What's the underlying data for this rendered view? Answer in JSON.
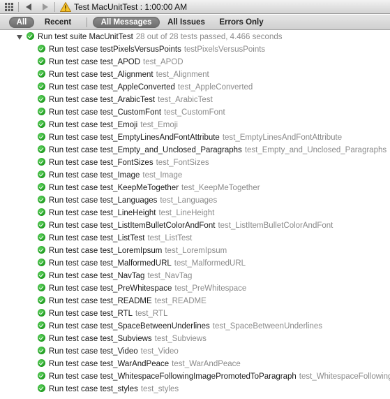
{
  "toolbar": {
    "title": "Test MacUnitTest : 1:00:00 AM"
  },
  "filters": {
    "scope": [
      {
        "label": "All",
        "selected": true
      },
      {
        "label": "Recent",
        "selected": false
      }
    ],
    "kind": [
      {
        "label": "All Messages",
        "selected": true
      },
      {
        "label": "All Issues",
        "selected": false
      },
      {
        "label": "Errors Only",
        "selected": false
      }
    ]
  },
  "suite": {
    "label": "Run test suite MacUnitTest",
    "detail": "28 out of 28 tests passed, 4.466 seconds"
  },
  "tests": [
    {
      "label": "Run test case testPixelsVersusPoints",
      "detail": "testPixelsVersusPoints"
    },
    {
      "label": "Run test case test_APOD",
      "detail": "test_APOD"
    },
    {
      "label": "Run test case test_Alignment",
      "detail": "test_Alignment"
    },
    {
      "label": "Run test case test_AppleConverted",
      "detail": "test_AppleConverted"
    },
    {
      "label": "Run test case test_ArabicTest",
      "detail": "test_ArabicTest"
    },
    {
      "label": "Run test case test_CustomFont",
      "detail": "test_CustomFont"
    },
    {
      "label": "Run test case test_Emoji",
      "detail": "test_Emoji"
    },
    {
      "label": "Run test case test_EmptyLinesAndFontAttribute",
      "detail": "test_EmptyLinesAndFontAttribute"
    },
    {
      "label": "Run test case test_Empty_and_Unclosed_Paragraphs",
      "detail": "test_Empty_and_Unclosed_Paragraphs"
    },
    {
      "label": "Run test case test_FontSizes",
      "detail": "test_FontSizes"
    },
    {
      "label": "Run test case test_Image",
      "detail": "test_Image"
    },
    {
      "label": "Run test case test_KeepMeTogether",
      "detail": "test_KeepMeTogether"
    },
    {
      "label": "Run test case test_Languages",
      "detail": "test_Languages"
    },
    {
      "label": "Run test case test_LineHeight",
      "detail": "test_LineHeight"
    },
    {
      "label": "Run test case test_ListItemBulletColorAndFont",
      "detail": "test_ListItemBulletColorAndFont"
    },
    {
      "label": "Run test case test_ListTest",
      "detail": "test_ListTest"
    },
    {
      "label": "Run test case test_LoremIpsum",
      "detail": "test_LoremIpsum"
    },
    {
      "label": "Run test case test_MalformedURL",
      "detail": "test_MalformedURL"
    },
    {
      "label": "Run test case test_NavTag",
      "detail": "test_NavTag"
    },
    {
      "label": "Run test case test_PreWhitespace",
      "detail": "test_PreWhitespace"
    },
    {
      "label": "Run test case test_README",
      "detail": "test_README"
    },
    {
      "label": "Run test case test_RTL",
      "detail": "test_RTL"
    },
    {
      "label": "Run test case test_SpaceBetweenUnderlines",
      "detail": "test_SpaceBetweenUnderlines"
    },
    {
      "label": "Run test case test_Subviews",
      "detail": "test_Subviews"
    },
    {
      "label": "Run test case test_Video",
      "detail": "test_Video"
    },
    {
      "label": "Run test case test_WarAndPeace",
      "detail": "test_WarAndPeace"
    },
    {
      "label": "Run test case test_WhitespaceFollowingImagePromotedToParagraph",
      "detail": "test_WhitespaceFollowingImagePromotedToParagraph"
    },
    {
      "label": "Run test case test_styles",
      "detail": "test_styles"
    }
  ],
  "icons": {
    "grid": "grid-icon",
    "back": "back-arrow-icon",
    "forward": "forward-arrow-icon",
    "warning": "warning-triangle-icon",
    "pass": "green-checkmark-icon",
    "disclosure": "disclosure-triangle-icon"
  },
  "colors": {
    "pass": "#1e9a1e",
    "detail_text": "#8a8a8a",
    "selected_pill": "#7a7a7a"
  }
}
